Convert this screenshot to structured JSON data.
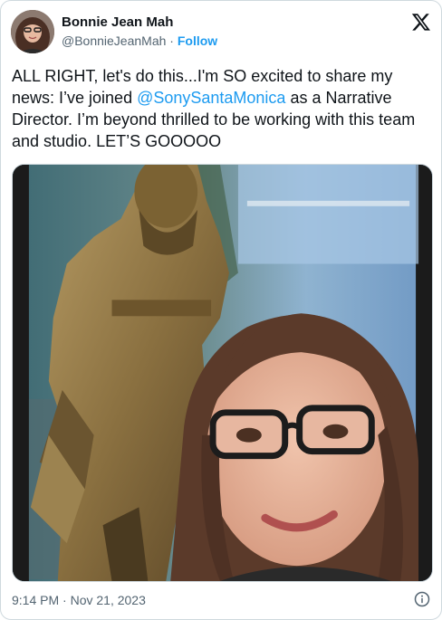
{
  "author": {
    "display_name": "Bonnie Jean Mah",
    "handle": "@BonnieJeanMah",
    "separator": "·",
    "follow_label": "Follow"
  },
  "tweet": {
    "text_before": "ALL RIGHT, let's do this...I'm SO excited to share my news: I’ve joined ",
    "mention": "@SonySantaMonica",
    "text_after": " as a Narrative Director. I’m beyond thrilled to be working with this team and studio. LET’S GOOOOO"
  },
  "footer": {
    "timestamp": "9:14 PM · Nov 21, 2023"
  },
  "icons": {
    "logo": "x-logo-icon",
    "info": "info-icon"
  },
  "colors": {
    "link": "#1d9bf0",
    "text": "#0f1419",
    "secondary": "#536471",
    "border": "#cfd9de"
  }
}
